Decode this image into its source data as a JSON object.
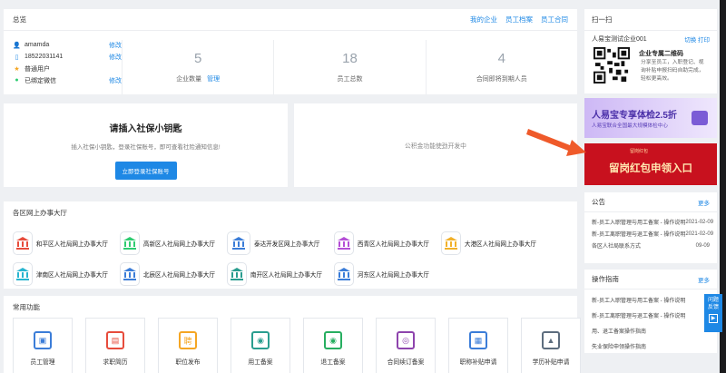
{
  "overview": {
    "title": "总览",
    "links": [
      "我的企业",
      "员工档案",
      "员工合同"
    ],
    "user": {
      "name": "amamda",
      "name_action": "修改",
      "phone": "18522031141",
      "phone_action": "修改",
      "role": "普通用户",
      "wechat": "已绑定微信",
      "wechat_action": "修改"
    },
    "stats": [
      {
        "value": "5",
        "label": "企业数量",
        "action": "管理"
      },
      {
        "value": "18",
        "label": "员工总数"
      },
      {
        "value": "4",
        "label": "合同即将到期人员"
      }
    ]
  },
  "key_card": {
    "title": "请插入社保小钥匙",
    "desc": "插入社保小钥匙，登录社保账号，即可查看社险通知信息!",
    "button": "立即登录社保账号"
  },
  "fund_card": {
    "text": "公积金功能使劲开发中"
  },
  "halls": {
    "title": "各区网上办事大厅",
    "colors": [
      "#e74c3c",
      "#2ecc71",
      "#3b7dd8",
      "#b44fd6",
      "#f1b12a",
      "#28b5d0",
      "#3b7dd8",
      "#2a9d8f",
      "#3b7dd8"
    ],
    "items": [
      "和平区人社局网上办事大厅",
      "高新区人社局网上办事大厅",
      "泰达开发区网上办事大厅",
      "西青区人社局网上办事大厅",
      "大港区人社局网上办事大厅",
      "津南区人社局网上办事大厅",
      "北辰区人社局网上办事大厅",
      "南开区人社局网上办事大厅",
      "河东区人社局网上办事大厅"
    ]
  },
  "functions": {
    "title": "常用功能",
    "items": [
      {
        "label": "员工管理",
        "color": "#3b7dd8",
        "glyph": "▣"
      },
      {
        "label": "求职简历",
        "color": "#e74c3c",
        "glyph": "▤"
      },
      {
        "label": "职位发布",
        "color": "#f5a623",
        "glyph": "聘"
      },
      {
        "label": "用工备案",
        "color": "#2a9d8f",
        "glyph": "◉"
      },
      {
        "label": "退工备案",
        "color": "#27ae60",
        "glyph": "◉"
      },
      {
        "label": "合同续订备案",
        "color": "#8e44ad",
        "glyph": "◎"
      },
      {
        "label": "职称补贴申请",
        "color": "#3b7dd8",
        "glyph": "▦"
      },
      {
        "label": "学历补贴申请",
        "color": "#5d6d7e",
        "glyph": "▲"
      }
    ]
  },
  "scan": {
    "title": "扫一扫",
    "company": "人易宝测试企业001",
    "actions": "切换 打印",
    "qr_title": "企业专属二维码",
    "qr_desc": "分享至员工，入职登记、视询补贴申报扫码自助完成，轻松更高效。"
  },
  "banner1": {
    "title": "人易宝专享体检2.5折",
    "sub": "人易宝联合全国最大规模体检中心"
  },
  "banner2": {
    "title": "留岗红包申领入口",
    "tag": "留岗红包"
  },
  "announcements": {
    "title": "公告",
    "more": "更多",
    "items": [
      {
        "text": "新-员工入职管理与用工备案 - 操作说明",
        "date": "2021-02-09"
      },
      {
        "text": "新-员工离职管理与退工备案 - 操作说明",
        "date": "2021-02-09"
      },
      {
        "text": "各区人社局联系方式",
        "date": "09-09"
      }
    ]
  },
  "guide": {
    "title": "操作指南",
    "more": "更多",
    "items": [
      "新-员工入职管理与用工备案 - 操作说明",
      "新-员工离职管理与退工备案 - 操作说明",
      "用、退工备案操作指南",
      "失业保险申领操作指南"
    ]
  },
  "side_tab": {
    "line1": "问题",
    "line2": "反馈"
  }
}
